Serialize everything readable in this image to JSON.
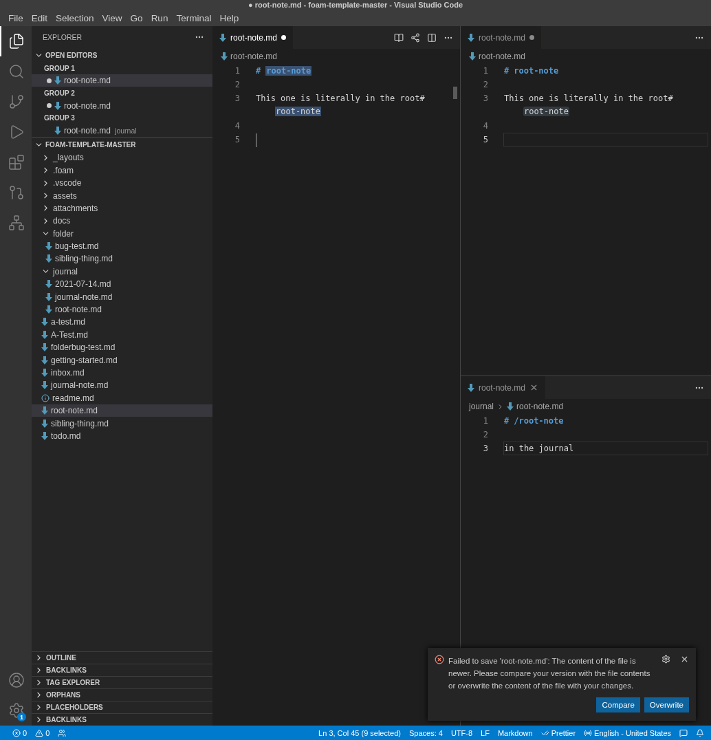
{
  "window": {
    "title": "● root-note.md - foam-template-master - Visual Studio Code"
  },
  "menu": [
    "File",
    "Edit",
    "Selection",
    "View",
    "Go",
    "Run",
    "Terminal",
    "Help"
  ],
  "activity_bar": {
    "top": [
      {
        "kind": "explorer",
        "selected": true
      },
      {
        "kind": "search",
        "selected": false
      },
      {
        "kind": "source-control",
        "selected": false
      },
      {
        "kind": "run",
        "selected": false
      },
      {
        "kind": "extensions",
        "selected": false
      },
      {
        "kind": "graph",
        "selected": false
      },
      {
        "kind": "tree",
        "selected": false
      }
    ],
    "bottom": [
      {
        "kind": "account",
        "selected": false
      },
      {
        "kind": "settings",
        "selected": false,
        "badge": "1"
      }
    ]
  },
  "sidebar": {
    "title": "EXPLORER",
    "open_editors": {
      "title": "OPEN EDITORS",
      "expanded": true,
      "groups": [
        {
          "title": "GROUP 1",
          "editors": [
            {
              "name": "root-note.md",
              "dirty": true,
              "selected": true
            }
          ]
        },
        {
          "title": "GROUP 2",
          "editors": [
            {
              "name": "root-note.md",
              "dirty": true,
              "selected": false
            }
          ]
        },
        {
          "title": "GROUP 3",
          "editors": [
            {
              "name": "root-note.md",
              "description": "journal",
              "dirty": false,
              "selected": false
            }
          ]
        }
      ]
    },
    "folder": {
      "title": "FOAM-TEMPLATE-MASTER",
      "expanded": true,
      "items": [
        {
          "kind": "folder",
          "name": "_layouts",
          "expanded": false,
          "selected": false
        },
        {
          "kind": "folder",
          "name": ".foam",
          "expanded": false,
          "selected": false
        },
        {
          "kind": "folder",
          "name": ".vscode",
          "expanded": false,
          "selected": false
        },
        {
          "kind": "folder",
          "name": "assets",
          "expanded": false,
          "selected": false
        },
        {
          "kind": "folder",
          "name": "attachments",
          "expanded": false,
          "selected": false
        },
        {
          "kind": "folder",
          "name": "docs",
          "expanded": false,
          "selected": false
        },
        {
          "kind": "folder",
          "name": "folder",
          "expanded": true,
          "selected": false,
          "children": [
            {
              "kind": "markdown",
              "name": "bug-test.md",
              "selected": false
            },
            {
              "kind": "markdown",
              "name": "sibling-thing.md",
              "selected": false
            }
          ]
        },
        {
          "kind": "folder",
          "name": "journal",
          "expanded": true,
          "selected": false,
          "children": [
            {
              "kind": "markdown",
              "name": "2021-07-14.md",
              "selected": false
            },
            {
              "kind": "markdown",
              "name": "journal-note.md",
              "selected": false
            },
            {
              "kind": "markdown",
              "name": "root-note.md",
              "selected": false
            }
          ]
        },
        {
          "kind": "markdown",
          "name": "a-test.md",
          "selected": false
        },
        {
          "kind": "markdown",
          "name": "A-Test.md",
          "selected": false
        },
        {
          "kind": "markdown",
          "name": "folderbug-test.md",
          "selected": false
        },
        {
          "kind": "markdown",
          "name": "getting-started.md",
          "selected": false
        },
        {
          "kind": "markdown",
          "name": "inbox.md",
          "selected": false
        },
        {
          "kind": "markdown",
          "name": "journal-note.md",
          "selected": false
        },
        {
          "kind": "info",
          "name": "readme.md",
          "selected": false
        },
        {
          "kind": "markdown",
          "name": "root-note.md",
          "selected": true
        },
        {
          "kind": "markdown",
          "name": "sibling-thing.md",
          "selected": false
        },
        {
          "kind": "markdown",
          "name": "todo.md",
          "selected": false
        }
      ]
    },
    "panels": [
      {
        "title": "OUTLINE",
        "expanded": false
      },
      {
        "title": "BACKLINKS",
        "expanded": false
      },
      {
        "title": "TAG EXPLORER",
        "expanded": false
      },
      {
        "title": "ORPHANS",
        "expanded": false
      },
      {
        "title": "PLACEHOLDERS",
        "expanded": false
      },
      {
        "title": "BACKLINKS",
        "expanded": false
      }
    ]
  },
  "editor_groups": [
    {
      "tabs": [
        {
          "label": "root-note.md",
          "dirty": true,
          "active": true
        }
      ],
      "actions": [
        {
          "kind": "preview"
        },
        {
          "kind": "graph"
        },
        {
          "kind": "split"
        },
        {
          "kind": "more"
        }
      ],
      "breadcrumbs": [
        {
          "kind": "file",
          "label": "root-note.md"
        }
      ],
      "lines": [
        {
          "number": "1",
          "kind": "heading",
          "marker": "#",
          "text": "root-note",
          "highlight": {
            "kind": "selection"
          },
          "current": false,
          "cursor": false
        },
        {
          "number": "2",
          "kind": "empty",
          "current": false,
          "cursor": false
        },
        {
          "number": "3",
          "kind": "text",
          "text": "This one is literally in the root#",
          "continuation": "root-note",
          "highlight": {
            "kind": "selection"
          },
          "current": false,
          "cursor": false
        },
        {
          "number": "4",
          "kind": "empty",
          "current": false,
          "cursor": false
        },
        {
          "number": "5",
          "kind": "empty",
          "current": false,
          "cursor": true
        }
      ]
    },
    {
      "tabs": [
        {
          "label": "root-note.md",
          "dirty": true,
          "active": false
        }
      ],
      "actions": [
        {
          "kind": "more"
        }
      ],
      "breadcrumbs": [
        {
          "kind": "file",
          "label": "root-note.md"
        }
      ],
      "lines": [
        {
          "number": "1",
          "kind": "heading",
          "marker": "#",
          "text": "root-note",
          "current": false,
          "cursor": false
        },
        {
          "number": "2",
          "kind": "empty",
          "current": false,
          "cursor": false
        },
        {
          "number": "3",
          "kind": "text",
          "text": "This one is literally in the root#",
          "continuation": "root-note",
          "highlight": {
            "kind": "box"
          },
          "current": false,
          "cursor": false
        },
        {
          "number": "4",
          "kind": "empty",
          "current": false,
          "cursor": false
        },
        {
          "number": "5",
          "kind": "empty",
          "current": true,
          "cursor": false
        }
      ]
    },
    {
      "tabs": [
        {
          "label": "root-note.md",
          "dirty": false,
          "active": false
        }
      ],
      "actions": [
        {
          "kind": "more"
        }
      ],
      "breadcrumbs": [
        {
          "kind": "folder",
          "label": "journal"
        },
        {
          "kind": "file",
          "label": "root-note.md"
        }
      ],
      "lines": [
        {
          "number": "1",
          "kind": "heading",
          "marker": "#",
          "text": "/root-note",
          "current": false,
          "cursor": false
        },
        {
          "number": "2",
          "kind": "empty",
          "current": false,
          "cursor": false
        },
        {
          "number": "3",
          "kind": "text",
          "text": "in the journal",
          "current": true,
          "cursor": false
        }
      ]
    }
  ],
  "notification": {
    "kind": "error",
    "message": "Failed to save 'root-note.md': The content of the file is newer. Please compare your version with the file contents or overwrite the content of the file with your changes.",
    "buttons": [
      "Compare",
      "Overwrite"
    ]
  },
  "status_bar": {
    "left": [
      {
        "kind": "errors",
        "label": "0"
      },
      {
        "kind": "warnings",
        "label": "0"
      },
      {
        "kind": "live-share"
      }
    ],
    "right": [
      {
        "kind": "text",
        "label": "Ln 3, Col 45 (9 selected)"
      },
      {
        "kind": "text",
        "label": "Spaces: 4"
      },
      {
        "kind": "text",
        "label": "UTF-8"
      },
      {
        "kind": "text",
        "label": "LF"
      },
      {
        "kind": "text",
        "label": "Markdown"
      },
      {
        "kind": "prettier",
        "label": "Prettier"
      },
      {
        "kind": "spell",
        "label": "English - United States"
      },
      {
        "kind": "feedback"
      },
      {
        "kind": "bell"
      }
    ]
  }
}
